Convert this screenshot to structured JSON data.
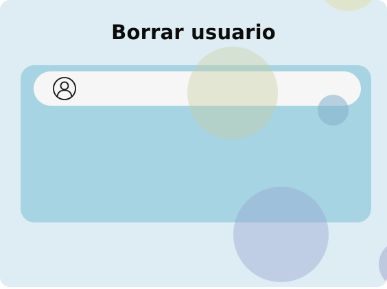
{
  "window": {
    "title": "Borrar usuario",
    "background_color": "#deedf3"
  },
  "form": {
    "panel_color": "#a6d4e3",
    "user_field": {
      "icon": "user-icon",
      "value": "",
      "placeholder": ""
    }
  },
  "decorations": {
    "circles": [
      "pale-yellow",
      "olive",
      "blue-small",
      "lavender-large",
      "lavender-edge"
    ]
  }
}
